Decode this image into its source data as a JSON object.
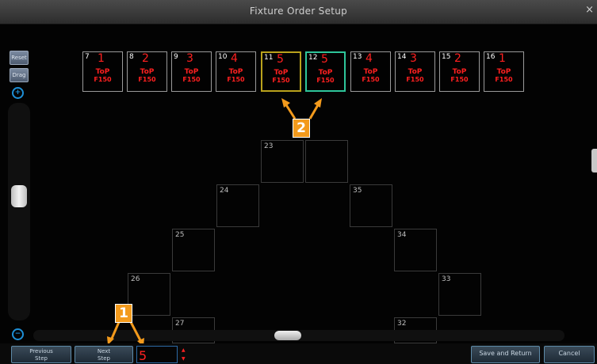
{
  "window": {
    "title": "Fixture Order Setup",
    "close": "×"
  },
  "sidebar": {
    "reset_label": "Reset",
    "drag_label": "Drag",
    "zoom_in": "+",
    "zoom_out": "−"
  },
  "fixtures": [
    {
      "id": "7",
      "order": "1",
      "logo_top": "ToP",
      "logo_bottom": "F150"
    },
    {
      "id": "8",
      "order": "2",
      "logo_top": "ToP",
      "logo_bottom": "F150"
    },
    {
      "id": "9",
      "order": "3",
      "logo_top": "ToP",
      "logo_bottom": "F150"
    },
    {
      "id": "10",
      "order": "4",
      "logo_top": "ToP",
      "logo_bottom": "F150"
    },
    {
      "id": "11",
      "order": "5",
      "logo_top": "ToP",
      "logo_bottom": "F150"
    },
    {
      "id": "12",
      "order": "5",
      "logo_top": "ToP",
      "logo_bottom": "F150"
    },
    {
      "id": "13",
      "order": "4",
      "logo_top": "ToP",
      "logo_bottom": "F150"
    },
    {
      "id": "14",
      "order": "3",
      "logo_top": "ToP",
      "logo_bottom": "F150"
    },
    {
      "id": "15",
      "order": "2",
      "logo_top": "ToP",
      "logo_bottom": "F150"
    },
    {
      "id": "16",
      "order": "1",
      "logo_top": "ToP",
      "logo_bottom": "F150"
    }
  ],
  "slots": [
    "23",
    "24",
    "35",
    "25",
    "34",
    "26",
    "33",
    "27",
    "32"
  ],
  "callouts": {
    "one": "1",
    "two": "2"
  },
  "bottom": {
    "previous_line1": "Previous",
    "previous_line2": "Step",
    "next_line1": "Next",
    "next_line2": "Step",
    "step_value": "5",
    "spin_up": "▲",
    "spin_down": "▼",
    "save_label": "Save and Return",
    "cancel_label": "Cancel"
  },
  "colors": {
    "order_red": "#ff2020",
    "callout_orange": "#f39a1c",
    "selected_yellow": "#b9a21c",
    "selected_green": "#2ec59a"
  }
}
